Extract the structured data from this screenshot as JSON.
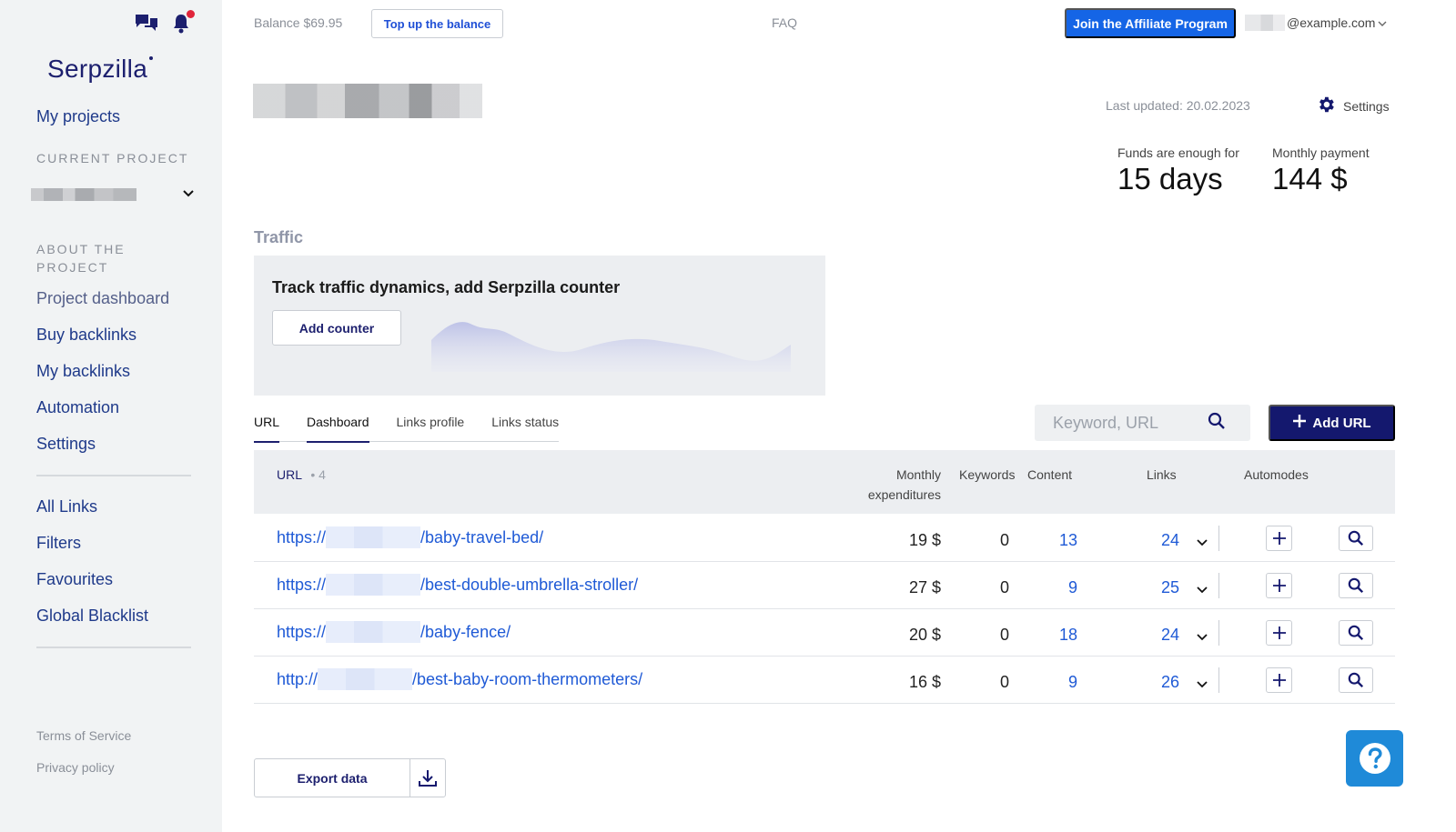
{
  "sidebar": {
    "logo": "Serpzilla",
    "my_projects": "My projects",
    "current_project_caption": "CURRENT PROJECT",
    "about_caption": "ABOUT THE PROJECT",
    "about_items": [
      {
        "label": "Project dashboard"
      },
      {
        "label": "Buy backlinks"
      },
      {
        "label": "My backlinks"
      },
      {
        "label": "Automation"
      },
      {
        "label": "Settings"
      }
    ],
    "general_items": [
      {
        "label": "All Links"
      },
      {
        "label": "Filters"
      },
      {
        "label": "Favourites"
      },
      {
        "label": "Global Blacklist"
      }
    ],
    "footer": {
      "terms": "Terms of Service",
      "privacy": "Privacy policy"
    }
  },
  "header": {
    "balance": "Balance $69.95",
    "topup": "Top up the balance",
    "faq": "FAQ",
    "affiliate": "Join the Affiliate Program",
    "email_suffix": "@example.com"
  },
  "project": {
    "last_updated": "Last updated: 20.02.2023",
    "settings": "Settings",
    "funds_label": "Funds are enough for",
    "funds_value": "15 days",
    "monthly_label": "Monthly payment",
    "monthly_value": "144 $"
  },
  "traffic": {
    "title": "Traffic",
    "heading": "Track traffic dynamics, add Serpzilla counter",
    "add_counter": "Add counter"
  },
  "tabs": [
    {
      "label": "URL"
    },
    {
      "label": "Dashboard"
    },
    {
      "label": "Links profile"
    },
    {
      "label": "Links status"
    }
  ],
  "search": {
    "placeholder": "Keyword, URL"
  },
  "add_url": "Add URL",
  "table": {
    "headers": {
      "url": "URL",
      "count": "• 4",
      "monthly_1": "Monthly",
      "monthly_2": "expenditures",
      "keywords": "Keywords",
      "content": "Content",
      "links": "Links",
      "automodes": "Automodes"
    },
    "rows": [
      {
        "scheme": "https://",
        "path": "/baby-travel-bed/",
        "expenditures": "19 $",
        "keywords": "0",
        "content": "13",
        "links": "24"
      },
      {
        "scheme": "https://",
        "path": "/best-double-umbrella-stroller/",
        "expenditures": "27 $",
        "keywords": "0",
        "content": "9",
        "links": "25"
      },
      {
        "scheme": "https://",
        "path": "/baby-fence/",
        "expenditures": "20 $",
        "keywords": "0",
        "content": "18",
        "links": "24"
      },
      {
        "scheme": "http://",
        "path": "/best-baby-room-thermometers/",
        "expenditures": "16 $",
        "keywords": "0",
        "content": "9",
        "links": "26"
      }
    ]
  },
  "export": "Export data",
  "colors": {
    "accent": "#1565e6",
    "brand": "#14186e",
    "link": "#1f5ad6",
    "notification": "#e0243a",
    "help": "#1f8ad8"
  }
}
